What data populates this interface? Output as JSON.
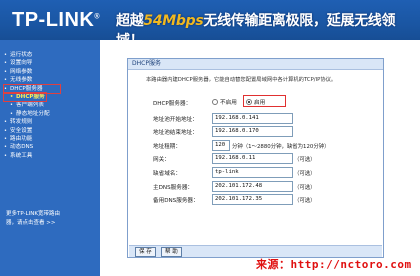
{
  "header": {
    "logo": "TP-LINK",
    "logo_reg": "®",
    "slogan_pre": "超越",
    "slogan_speed": "54Mbps",
    "slogan_post": "无线传输距离极限，延展无线领域！"
  },
  "sidebar": {
    "items": [
      {
        "label": "运行状态"
      },
      {
        "label": "设置向导"
      },
      {
        "label": "网络参数"
      },
      {
        "label": "无线参数"
      },
      {
        "label": "DHCP服务器"
      },
      {
        "label": "DHCP服务"
      },
      {
        "label": "客户端列表"
      },
      {
        "label": "静态地址分配"
      },
      {
        "label": "转发规则"
      },
      {
        "label": "安全设置"
      },
      {
        "label": "路由功能"
      },
      {
        "label": "动态DNS"
      },
      {
        "label": "系统工具"
      }
    ],
    "footer_line1": "更多TP-LINK宽带路由",
    "footer_line2": "器，请点击查看 >>"
  },
  "panel": {
    "title": "DHCP服务",
    "intro": "本路由器内建DHCP服务器，它能自动替您配置局域网中各计算机的TCP/IP协议。"
  },
  "form": {
    "dhcp_label": "DHCP服务器：",
    "disable_label": "不启用",
    "enable_label": "启用",
    "start_label": "地址池开始地址：",
    "start_value": "192.168.0.141",
    "end_label": "地址池结束地址：",
    "end_value": "192.168.0.170",
    "lease_label": "地址租期：",
    "lease_value": "120",
    "lease_suffix": "分钟（1～2880分钟，缺省为120分钟）",
    "gateway_label": "网关：",
    "gateway_value": "192.168.0.11",
    "gateway_suffix": "（可选）",
    "domain_label": "缺省域名：",
    "domain_value": "tp-link",
    "domain_suffix": "（可选）",
    "dns1_label": "主DNS服务器：",
    "dns1_value": "202.101.172.48",
    "dns1_suffix": "（可选）",
    "dns2_label": "备用DNS服务器：",
    "dns2_value": "202.101.172.35",
    "dns2_suffix": "（可选）"
  },
  "buttons": {
    "save": "保 存",
    "help": "帮 助"
  },
  "watermark": "来源：http://nctoro.com"
}
